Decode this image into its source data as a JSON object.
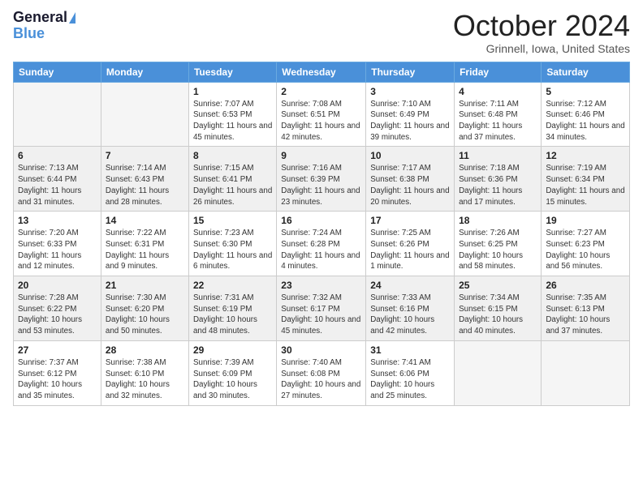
{
  "logo": {
    "line1": "General",
    "line2": "Blue"
  },
  "title": "October 2024",
  "location": "Grinnell, Iowa, United States",
  "days_of_week": [
    "Sunday",
    "Monday",
    "Tuesday",
    "Wednesday",
    "Thursday",
    "Friday",
    "Saturday"
  ],
  "weeks": [
    [
      {
        "day": "",
        "info": ""
      },
      {
        "day": "",
        "info": ""
      },
      {
        "day": "1",
        "info": "Sunrise: 7:07 AM\nSunset: 6:53 PM\nDaylight: 11 hours and 45 minutes."
      },
      {
        "day": "2",
        "info": "Sunrise: 7:08 AM\nSunset: 6:51 PM\nDaylight: 11 hours and 42 minutes."
      },
      {
        "day": "3",
        "info": "Sunrise: 7:10 AM\nSunset: 6:49 PM\nDaylight: 11 hours and 39 minutes."
      },
      {
        "day": "4",
        "info": "Sunrise: 7:11 AM\nSunset: 6:48 PM\nDaylight: 11 hours and 37 minutes."
      },
      {
        "day": "5",
        "info": "Sunrise: 7:12 AM\nSunset: 6:46 PM\nDaylight: 11 hours and 34 minutes."
      }
    ],
    [
      {
        "day": "6",
        "info": "Sunrise: 7:13 AM\nSunset: 6:44 PM\nDaylight: 11 hours and 31 minutes."
      },
      {
        "day": "7",
        "info": "Sunrise: 7:14 AM\nSunset: 6:43 PM\nDaylight: 11 hours and 28 minutes."
      },
      {
        "day": "8",
        "info": "Sunrise: 7:15 AM\nSunset: 6:41 PM\nDaylight: 11 hours and 26 minutes."
      },
      {
        "day": "9",
        "info": "Sunrise: 7:16 AM\nSunset: 6:39 PM\nDaylight: 11 hours and 23 minutes."
      },
      {
        "day": "10",
        "info": "Sunrise: 7:17 AM\nSunset: 6:38 PM\nDaylight: 11 hours and 20 minutes."
      },
      {
        "day": "11",
        "info": "Sunrise: 7:18 AM\nSunset: 6:36 PM\nDaylight: 11 hours and 17 minutes."
      },
      {
        "day": "12",
        "info": "Sunrise: 7:19 AM\nSunset: 6:34 PM\nDaylight: 11 hours and 15 minutes."
      }
    ],
    [
      {
        "day": "13",
        "info": "Sunrise: 7:20 AM\nSunset: 6:33 PM\nDaylight: 11 hours and 12 minutes."
      },
      {
        "day": "14",
        "info": "Sunrise: 7:22 AM\nSunset: 6:31 PM\nDaylight: 11 hours and 9 minutes."
      },
      {
        "day": "15",
        "info": "Sunrise: 7:23 AM\nSunset: 6:30 PM\nDaylight: 11 hours and 6 minutes."
      },
      {
        "day": "16",
        "info": "Sunrise: 7:24 AM\nSunset: 6:28 PM\nDaylight: 11 hours and 4 minutes."
      },
      {
        "day": "17",
        "info": "Sunrise: 7:25 AM\nSunset: 6:26 PM\nDaylight: 11 hours and 1 minute."
      },
      {
        "day": "18",
        "info": "Sunrise: 7:26 AM\nSunset: 6:25 PM\nDaylight: 10 hours and 58 minutes."
      },
      {
        "day": "19",
        "info": "Sunrise: 7:27 AM\nSunset: 6:23 PM\nDaylight: 10 hours and 56 minutes."
      }
    ],
    [
      {
        "day": "20",
        "info": "Sunrise: 7:28 AM\nSunset: 6:22 PM\nDaylight: 10 hours and 53 minutes."
      },
      {
        "day": "21",
        "info": "Sunrise: 7:30 AM\nSunset: 6:20 PM\nDaylight: 10 hours and 50 minutes."
      },
      {
        "day": "22",
        "info": "Sunrise: 7:31 AM\nSunset: 6:19 PM\nDaylight: 10 hours and 48 minutes."
      },
      {
        "day": "23",
        "info": "Sunrise: 7:32 AM\nSunset: 6:17 PM\nDaylight: 10 hours and 45 minutes."
      },
      {
        "day": "24",
        "info": "Sunrise: 7:33 AM\nSunset: 6:16 PM\nDaylight: 10 hours and 42 minutes."
      },
      {
        "day": "25",
        "info": "Sunrise: 7:34 AM\nSunset: 6:15 PM\nDaylight: 10 hours and 40 minutes."
      },
      {
        "day": "26",
        "info": "Sunrise: 7:35 AM\nSunset: 6:13 PM\nDaylight: 10 hours and 37 minutes."
      }
    ],
    [
      {
        "day": "27",
        "info": "Sunrise: 7:37 AM\nSunset: 6:12 PM\nDaylight: 10 hours and 35 minutes."
      },
      {
        "day": "28",
        "info": "Sunrise: 7:38 AM\nSunset: 6:10 PM\nDaylight: 10 hours and 32 minutes."
      },
      {
        "day": "29",
        "info": "Sunrise: 7:39 AM\nSunset: 6:09 PM\nDaylight: 10 hours and 30 minutes."
      },
      {
        "day": "30",
        "info": "Sunrise: 7:40 AM\nSunset: 6:08 PM\nDaylight: 10 hours and 27 minutes."
      },
      {
        "day": "31",
        "info": "Sunrise: 7:41 AM\nSunset: 6:06 PM\nDaylight: 10 hours and 25 minutes."
      },
      {
        "day": "",
        "info": ""
      },
      {
        "day": "",
        "info": ""
      }
    ]
  ]
}
